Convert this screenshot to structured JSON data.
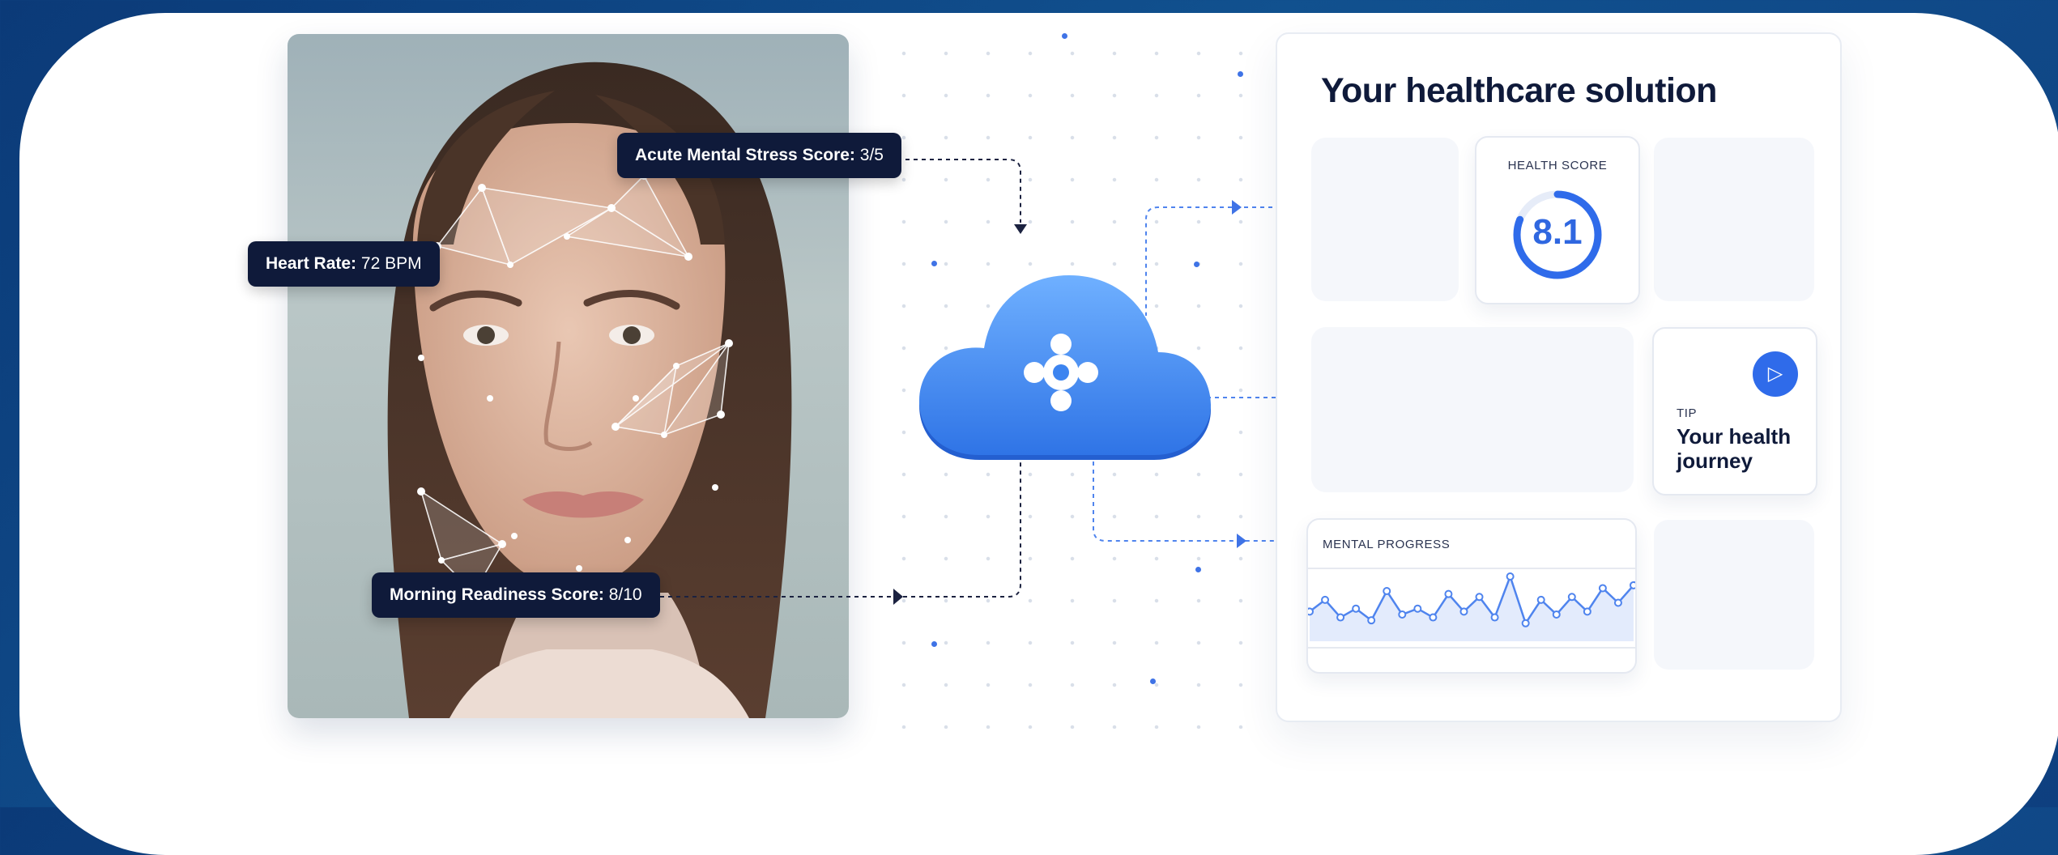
{
  "tags": {
    "stress_label": "Acute Mental Stress Score:",
    "stress_value": "3/5",
    "heart_label": "Heart Rate:",
    "heart_value": "72 BPM",
    "readiness_label": "Morning Readiness Score:",
    "readiness_value": "8/10"
  },
  "dashboard": {
    "title": "Your healthcare solution",
    "health_score": {
      "label": "HEALTH SCORE",
      "value": "8.1",
      "fraction": 0.81
    },
    "tip": {
      "label": "TIP",
      "title": "Your health journey"
    },
    "mental_progress": {
      "label": "MENTAL PROGRESS",
      "values": [
        6,
        10,
        4,
        7,
        3,
        13,
        5,
        7,
        4,
        12,
        6,
        11,
        4,
        18,
        2,
        10,
        5,
        11,
        6,
        14,
        9,
        15
      ]
    }
  },
  "icons": {
    "cloud": "cloud-icon",
    "logo": "app-logo-icon",
    "play": "play-icon",
    "photo": "face-scan-photo"
  },
  "colors": {
    "background": "#0e3f7f",
    "accent": "#2f6bea",
    "tag_bg": "#0f1a3a",
    "cloud": "#4a90f5"
  }
}
